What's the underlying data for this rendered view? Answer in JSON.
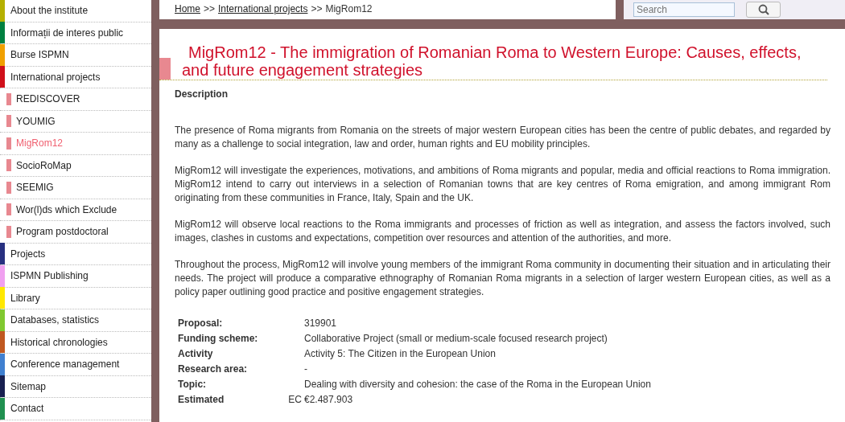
{
  "sidebar": {
    "items": [
      {
        "label": "About the institute",
        "color": "#b5b000",
        "selected": false
      },
      {
        "label": "Informații de interes public",
        "color": "#008040",
        "selected": false
      },
      {
        "label": "Burse ISPMN",
        "color": "#f0a000",
        "selected": false
      },
      {
        "label": "International projects",
        "color": "#d0101a",
        "selected": false,
        "children": [
          {
            "label": "REDISCOVER",
            "selected": false
          },
          {
            "label": "YOUMIG",
            "selected": false
          },
          {
            "label": "MigRom12",
            "selected": true
          },
          {
            "label": "SocioRoMap",
            "selected": false
          },
          {
            "label": "SEEMIG",
            "selected": false
          },
          {
            "label": "Wor(l)ds which Exclude",
            "selected": false
          },
          {
            "label": "Program postdoctoral",
            "selected": false
          }
        ]
      },
      {
        "label": "Projects",
        "color": "#283080",
        "selected": false
      },
      {
        "label": "ISPMN Publishing",
        "color": "#f0a0f0",
        "selected": false
      },
      {
        "label": "Library",
        "color": "#ffe800",
        "selected": false
      },
      {
        "label": "Databases, statistics",
        "color": "#80c830",
        "selected": false
      },
      {
        "label": "Historical chronologies",
        "color": "#c05820",
        "selected": false
      },
      {
        "label": "Conference management",
        "color": "#4080d0",
        "selected": false
      },
      {
        "label": "Sitemap",
        "color": "#182050",
        "selected": false
      },
      {
        "label": "Contact",
        "color": "#209050",
        "selected": false
      }
    ]
  },
  "breadcrumb": {
    "links": [
      "Home",
      "International projects"
    ],
    "separator": ">>",
    "current": "MigRom12"
  },
  "search": {
    "placeholder": "Search"
  },
  "article": {
    "title": "MigRom12 - The immigration of Romanian Roma to Western Europe: Causes, effects, and future engagement strategies",
    "section": "Description",
    "paragraphs": [
      "The presence of Roma migrants from Romania on the streets of major western European cities has been the centre of public debates, and regarded by many as a challenge to social integration, law and order, human rights and EU mobility principles.",
      "MigRom12 will investigate the experiences, motivations, and ambitions of Roma migrants and popular, media and official reactions to Roma immigration. MigRom12 intend to carry out interviews in a selection of Romanian towns that are key centres of Roma emigration, and among immigrant Rom originating from these communities in France, Italy, Spain and the UK.",
      "MigRom12 will observe local reactions to the Roma immigrants and processes of friction as well as integration, and assess the factors involved, such images, clashes in customs and expectations, competition over resources and attention of the authorities, and more.",
      "Throughout the process, MigRom12 will involve young members of the immigrant Roma community in documenting their situation and in articulating their needs. The project will produce a comparative ethnography of Romanian Roma migrants in a selection of larger western European cities, as well as a policy paper outlining good practice and positive engagement strategies."
    ],
    "details": [
      {
        "label": "Proposal:",
        "value": "319901"
      },
      {
        "label": "Funding scheme:",
        "value": "Collaborative Project (small or medium-scale focused research project)"
      },
      {
        "label": "Activity",
        "value": "Activity 5: The Citizen in the European Union"
      },
      {
        "label": "Research area:",
        "value": "-"
      },
      {
        "label": "Topic:",
        "value": "Dealing with diversity and cohesion: the case of the Roma in the European Union"
      },
      {
        "label": "Estimated",
        "lead": "EC",
        "value": "€2.487.903"
      }
    ]
  }
}
